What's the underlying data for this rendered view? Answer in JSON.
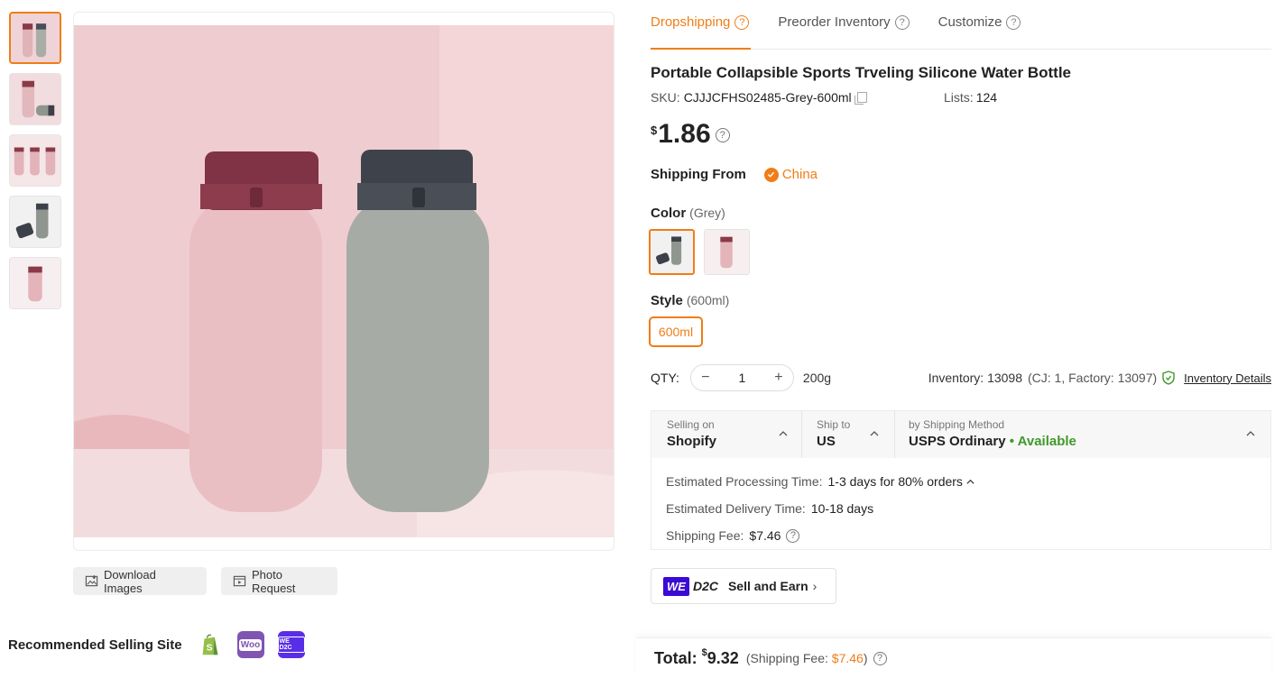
{
  "tabs": [
    {
      "label": "Dropshipping",
      "active": true
    },
    {
      "label": "Preorder Inventory",
      "active": false
    },
    {
      "label": "Customize",
      "active": false
    }
  ],
  "product": {
    "title": "Portable Collapsible Sports Trveling Silicone Water Bottle",
    "sku_label": "SKU:",
    "sku_value": "CJJJCFHS02485-Grey-600ml",
    "lists_label": "Lists:",
    "lists_value": "124",
    "price_currency": "$",
    "price_amount": "1.86"
  },
  "shipping_from": {
    "label": "Shipping From",
    "country": "China"
  },
  "color": {
    "label": "Color",
    "selected": "(Grey)",
    "options": [
      "grey-bottle-swatch",
      "pink-bottle-swatch"
    ]
  },
  "style": {
    "label": "Style",
    "selected": "(600ml)",
    "option": "600ml"
  },
  "qty": {
    "label": "QTY:",
    "value": "1",
    "minus": "−",
    "plus": "+",
    "weight": "200g"
  },
  "inventory": {
    "text": "Inventory: 13098",
    "detail": "(CJ: 1, Factory: 13097)",
    "link": "Inventory Details"
  },
  "shipping": {
    "selling_on_label": "Selling on",
    "selling_on_value": "Shopify",
    "ship_to_label": "Ship to",
    "ship_to_value": "US",
    "method_label": "by Shipping Method",
    "method_value": "USPS Ordinary",
    "method_status": "• Available",
    "processing_label": "Estimated Processing Time:",
    "processing_value": "1-3 days for 80% orders",
    "delivery_label": "Estimated Delivery Time:",
    "delivery_value": "10-18 days",
    "fee_label": "Shipping Fee:",
    "fee_value": "$7.46"
  },
  "d2c": {
    "badge": "WE",
    "d2c": "D2C",
    "label": "Sell and Earn",
    "arrow": "›"
  },
  "image_actions": {
    "download": "Download Images",
    "photo_request": "Photo Request"
  },
  "recommended": {
    "label": "Recommended Selling Site",
    "sites": [
      "shopify-icon",
      "woocommerce-icon",
      "wed2c-icon"
    ],
    "woo_text": "Woo",
    "wed2c_text": "WE D2C"
  },
  "total": {
    "label": "Total:",
    "currency": "$",
    "amount": "9.32",
    "fee_prefix": "(Shipping Fee:",
    "fee_value": "$7.46",
    "fee_suffix": ")"
  },
  "colors": {
    "accent": "#f07d17",
    "available": "#3f9a2b",
    "we_badge": "#3b0ad4"
  }
}
